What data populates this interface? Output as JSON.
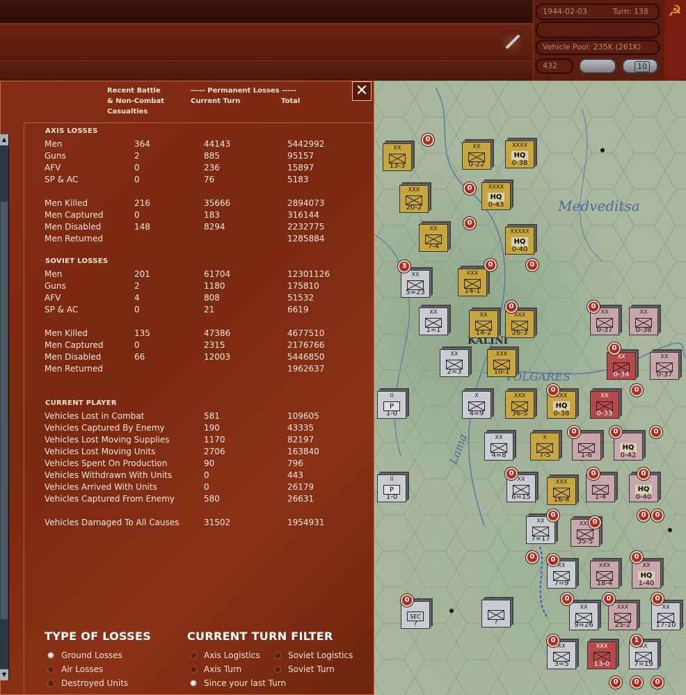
{
  "topbar": {
    "date": "1944-02-03",
    "turn": "Turn: 138",
    "vehicle_pool": "Vehicle Pool: 235K (261K)",
    "value_pill": "432",
    "ten_button": "10",
    "flag_icon": "hammer-sickle-icon"
  },
  "panel": {
    "hdr_recent": [
      "Recent Battle",
      "& Non-Combat",
      "Casualties"
    ],
    "hdr_permanent": "----- Permanent Losses -----",
    "hdr_current": "Current Turn",
    "hdr_total": "Total",
    "close": "✕",
    "axis": {
      "title": "AXIS LOSSES",
      "rows1": [
        {
          "label": "Men",
          "recent": "364",
          "current": "44143",
          "total": "5442992"
        },
        {
          "label": "Guns",
          "recent": "2",
          "current": "885",
          "total": "95157"
        },
        {
          "label": "AFV",
          "recent": "0",
          "current": "236",
          "total": "15897"
        },
        {
          "label": "SP & AC",
          "recent": "0",
          "current": "76",
          "total": "5183"
        }
      ],
      "rows2": [
        {
          "label": "Men Killed",
          "recent": "216",
          "current": "35666",
          "total": "2894073"
        },
        {
          "label": "Men Captured",
          "recent": "0",
          "current": "183",
          "total": "316144"
        },
        {
          "label": "Men Disabled",
          "recent": "148",
          "current": "8294",
          "total": "2232775"
        },
        {
          "label": "Men Returned",
          "recent": "",
          "current": "",
          "total": "1285884"
        }
      ]
    },
    "soviet": {
      "title": "SOVIET LOSSES",
      "rows1": [
        {
          "label": "Men",
          "recent": "201",
          "current": "61704",
          "total": "12301126"
        },
        {
          "label": "Guns",
          "recent": "2",
          "current": "1180",
          "total": "175810"
        },
        {
          "label": "AFV",
          "recent": "4",
          "current": "808",
          "total": "51532"
        },
        {
          "label": "SP & AC",
          "recent": "0",
          "current": "21",
          "total": "6619"
        }
      ],
      "rows2": [
        {
          "label": "Men Killed",
          "recent": "135",
          "current": "47386",
          "total": "4677510"
        },
        {
          "label": "Men Captured",
          "recent": "0",
          "current": "2315",
          "total": "2176766"
        },
        {
          "label": "Men Disabled",
          "recent": "66",
          "current": "12003",
          "total": "5446850"
        },
        {
          "label": "Men Returned",
          "recent": "",
          "current": "",
          "total": "1962637"
        }
      ]
    },
    "player": {
      "title": "CURRENT PLAYER",
      "rows": [
        {
          "label": "Vehicles Lost in Combat",
          "current": "581",
          "total": "109605"
        },
        {
          "label": "Vehicles Captured By Enemy",
          "current": "190",
          "total": "43335"
        },
        {
          "label": "Vehicles Lost Moving Supplies",
          "current": "1170",
          "total": "82197"
        },
        {
          "label": "Vehicles Lost Moving Units",
          "current": "2706",
          "total": "163840"
        },
        {
          "label": "Vehicles Spent On Production",
          "current": "90",
          "total": "796"
        },
        {
          "label": "Vehicles Withdrawn With Units",
          "current": "0",
          "total": "443"
        },
        {
          "label": "Vehicles Arrived With Units",
          "current": "0",
          "total": "26179"
        },
        {
          "label": "Vehicles Captured From Enemy",
          "current": "580",
          "total": "26631"
        }
      ],
      "damaged": {
        "label": "Vehicles Damaged To All Causes",
        "current": "31502",
        "total": "1954931"
      }
    },
    "type_of_losses": {
      "title": "TYPE OF LOSSES",
      "options": [
        "Ground Losses",
        "Air Losses",
        "Destroyed Units"
      ],
      "selected": 0
    },
    "turn_filter": {
      "title": "CURRENT TURN FILTER",
      "options": [
        "Axis Logistics",
        "Soviet Logistics",
        "Axis Turn",
        "Soviet Turn",
        "Since your last Turn"
      ],
      "selected": 4
    }
  },
  "map": {
    "labels": [
      "Medveditsa",
      "KALINI",
      "VOLGARES",
      "Lama"
    ],
    "counters": [
      {
        "ech": "XX",
        "str": "13-3",
        "type": "inf",
        "color": "yellow"
      },
      {
        "ech": "XX",
        "str": "0-22",
        "type": "other",
        "color": "yellow"
      },
      {
        "ech": "XXXX",
        "str": "0-38",
        "type": "hq",
        "color": "yellow"
      },
      {
        "ech": "XXX",
        "str": "20-2",
        "type": "inf",
        "color": "yellow"
      },
      {
        "ech": "XXXX",
        "str": "0-43",
        "type": "hq",
        "color": "yellow"
      },
      {
        "ech": "XX",
        "str": "7-4",
        "type": "inf",
        "color": "yellow"
      },
      {
        "ech": "XXXXX",
        "str": "0-40",
        "type": "hq",
        "color": "yellow"
      },
      {
        "ech": "XX",
        "str": "5=23",
        "type": "inf",
        "color": "gray"
      },
      {
        "ech": "XXX",
        "str": "14-1",
        "type": "inf",
        "color": "yellow"
      },
      {
        "ech": "XX",
        "str": "1=1",
        "type": "inf",
        "color": "gray"
      },
      {
        "ech": "XX",
        "str": "14-2",
        "type": "inf",
        "color": "yellow"
      },
      {
        "ech": "XXX",
        "str": "26-3",
        "type": "inf",
        "color": "yellow"
      },
      {
        "ech": "XX",
        "str": "0-37",
        "type": "other",
        "color": "pink"
      },
      {
        "ech": "XX",
        "str": "0-38",
        "type": "other",
        "color": "pink"
      },
      {
        "ech": "XX",
        "str": "2=3",
        "type": "inf",
        "color": "gray"
      },
      {
        "ech": "XXX",
        "str": "10-1",
        "type": "inf",
        "color": "yellow"
      },
      {
        "ech": "XX",
        "str": "0-34",
        "type": "other",
        "color": "red"
      },
      {
        "ech": "XX",
        "str": "0-37",
        "type": "other",
        "color": "pink"
      },
      {
        "ech": "II",
        "str": "1-0",
        "type": "p",
        "color": "gray"
      },
      {
        "ech": "X",
        "str": "4=9",
        "type": "inf",
        "color": "gray"
      },
      {
        "ech": "XXX",
        "str": "36-5",
        "type": "inf",
        "color": "yellow"
      },
      {
        "ech": "XXX",
        "str": "0-38",
        "type": "hq",
        "color": "yellow"
      },
      {
        "ech": "XX",
        "str": "0-33",
        "type": "other",
        "color": "red"
      },
      {
        "ech": "XX",
        "str": "4=8",
        "type": "inf",
        "color": "gray"
      },
      {
        "ech": "X",
        "str": "7-5",
        "type": "inf",
        "color": "yellow"
      },
      {
        "ech": "",
        "str": "1-6",
        "type": "inf",
        "color": "pink"
      },
      {
        "ech": "",
        "str": "0-42",
        "type": "hq",
        "color": "pink"
      },
      {
        "ech": "II",
        "str": "1-0",
        "type": "p",
        "color": "gray"
      },
      {
        "ech": "XX",
        "str": "6=15",
        "type": "inf",
        "color": "gray"
      },
      {
        "ech": "XXX",
        "str": "16-4",
        "type": "inf",
        "color": "yellow"
      },
      {
        "ech": "",
        "str": "1-4",
        "type": "other",
        "color": "pink"
      },
      {
        "ech": "",
        "str": "0-40",
        "type": "hq",
        "color": "pink"
      },
      {
        "ech": "XX",
        "str": "7=17",
        "type": "inf",
        "color": "gray"
      },
      {
        "ech": "XXX",
        "str": "35-5",
        "type": "inf",
        "color": "pink"
      },
      {
        "ech": "XX",
        "str": "7=9",
        "type": "inf",
        "color": "gray"
      },
      {
        "ech": "XXX",
        "str": "18-4",
        "type": "inf",
        "color": "pink"
      },
      {
        "ech": "XX",
        "str": "1-40",
        "type": "hq",
        "color": "pink"
      },
      {
        "ech": "",
        "str": "?",
        "type": "sec",
        "color": "gray"
      },
      {
        "ech": "",
        "str": "?",
        "type": "other",
        "color": "gray"
      },
      {
        "ech": "XX",
        "str": "9=26",
        "type": "inf",
        "color": "gray"
      },
      {
        "ech": "XXX",
        "str": "25-2",
        "type": "inf",
        "color": "pink"
      },
      {
        "ech": "XX",
        "str": "17-10",
        "type": "inf",
        "color": "gray"
      },
      {
        "ech": "XX",
        "str": "3=5",
        "type": "inf",
        "color": "gray"
      },
      {
        "ech": "XXX",
        "str": "13-0",
        "type": "inf",
        "color": "red"
      },
      {
        "ech": "XX",
        "str": "7=19",
        "type": "inf",
        "color": "gray"
      }
    ]
  }
}
